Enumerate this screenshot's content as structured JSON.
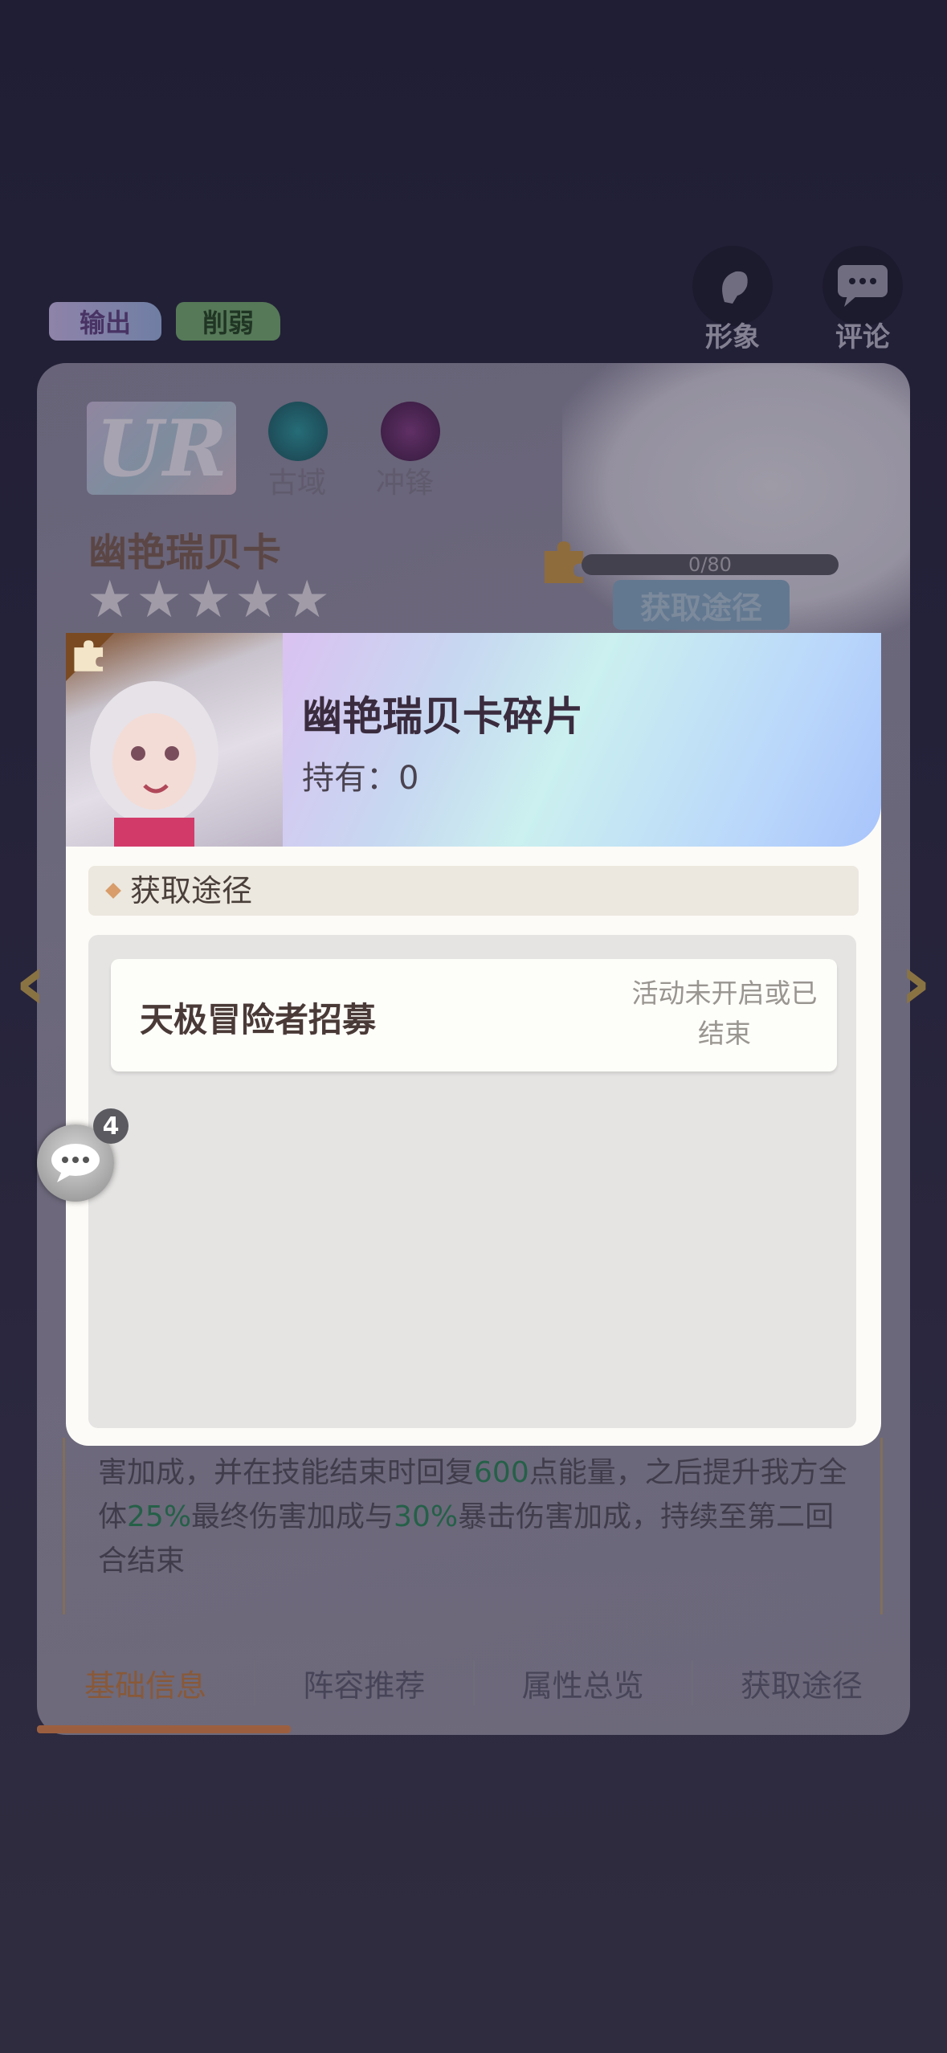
{
  "tags": {
    "output": "输出",
    "debuff": "削弱"
  },
  "top_buttons": {
    "appearance": "形象",
    "comments": "评论"
  },
  "hero": {
    "rarity": "UR",
    "faction": "古域",
    "class": "冲锋",
    "name": "幽艳瑞贝卡",
    "stars": "★★★★★",
    "shard_progress": "0/80",
    "get_button": "获取途径"
  },
  "description": {
    "part1": "害加成，并在技能结束时回复",
    "v1": "600",
    "part2": "点能量，之后提升我方全体",
    "v2": "25%",
    "part3": "最终伤害加成与",
    "v3": "30%",
    "part4": "暴击伤害加成，持续至第二回合结束"
  },
  "bottom_tabs": [
    {
      "label": "基础信息"
    },
    {
      "label": "阵容推荐"
    },
    {
      "label": "属性总览"
    },
    {
      "label": "获取途径"
    }
  ],
  "modal": {
    "title": "幽艳瑞贝卡碎片",
    "hold_label": "持有：",
    "hold_value": "0",
    "section_title": "获取途径",
    "routes": [
      {
        "name": "天极冒险者招募",
        "status": "活动未开启或已结束"
      }
    ]
  },
  "chat_float": {
    "badge": "4"
  },
  "nav": {
    "left_arrow": "‹",
    "right_arrow": "›"
  },
  "colors": {
    "accent": "#c8784a",
    "highlight_green": "#2b7a55",
    "modal_bg": "#fdfbf7"
  }
}
